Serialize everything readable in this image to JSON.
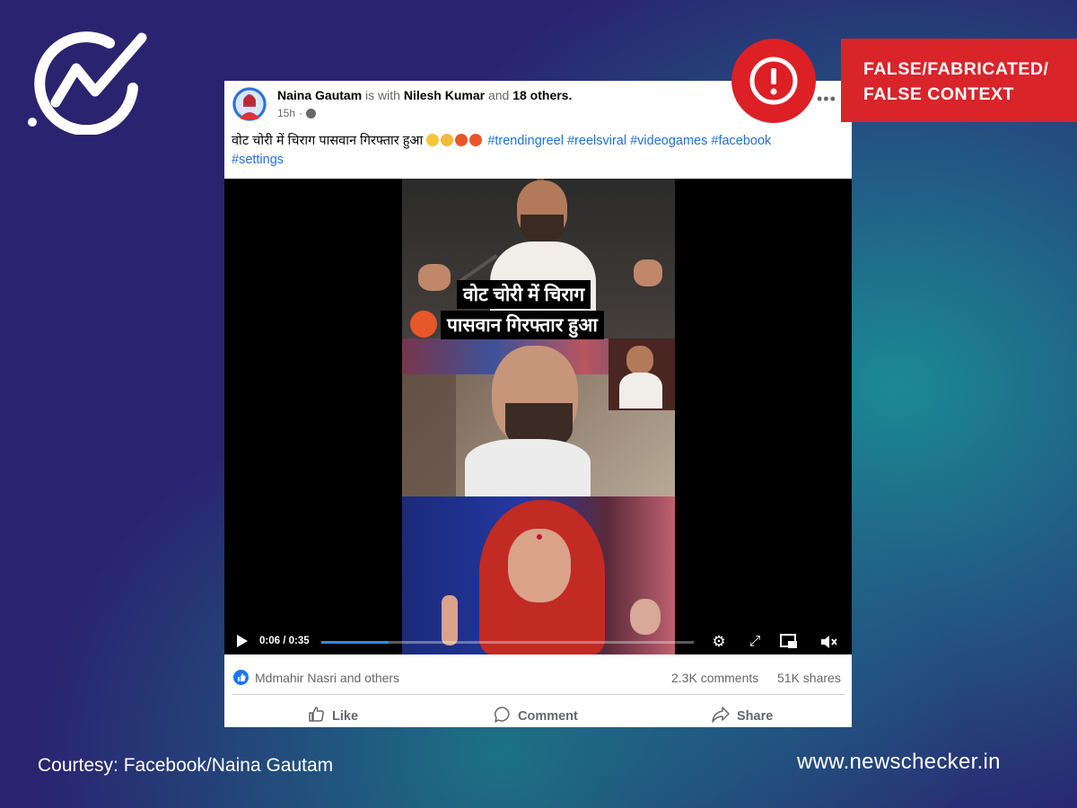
{
  "brand": {
    "logo_icon": "newschecker-check-logo-icon",
    "website": "www.newschecker.in"
  },
  "verdict": {
    "icon": "exclamation-alert-icon",
    "line1": "FALSE/FABRICATED/",
    "line2": "FALSE CONTEXT",
    "color": "#d9242a"
  },
  "courtesy": "Courtesy: Facebook/Naina Gautam",
  "post": {
    "author": "Naina Gautam",
    "with_text": " is with ",
    "tagged": "Nilesh Kumar",
    "and_text": " and ",
    "others": "18 others.",
    "time": "15h",
    "time_sep": " ·",
    "more_icon": "more-options-icon",
    "caption_text": "वोट चोरी में चिराग पासवान गिरफ्तार हुआ",
    "caption_emojis": [
      "sad-face-emoji",
      "shocked-face-emoji",
      "angry-face-emoji",
      "angry-face-emoji"
    ],
    "hashtags": [
      "#trendingreel",
      "#reelsviral",
      "#videogames",
      "#facebook",
      "#settings"
    ],
    "video": {
      "overlay_line1": "वोट चोरी में चिराग",
      "overlay_line2": "पासवान गिरफ्तार हुआ",
      "overlay_emoji": "angry-face-emoji",
      "time_display": "0:06 / 0:35",
      "progress": 0.18,
      "controls": [
        "play-icon",
        "settings-gear-icon",
        "fullscreen-icon",
        "picture-in-picture-icon",
        "mute-icon"
      ]
    },
    "reactions_text": "Mdmahir Nasri and others",
    "comments": "2.3K comments",
    "shares": "51K shares",
    "actions": {
      "like": "Like",
      "comment": "Comment",
      "share": "Share"
    }
  },
  "colors": {
    "facebook_blue": "#1877f2",
    "hashtag_blue": "#216fdb",
    "alert_red": "#dd1f26"
  }
}
